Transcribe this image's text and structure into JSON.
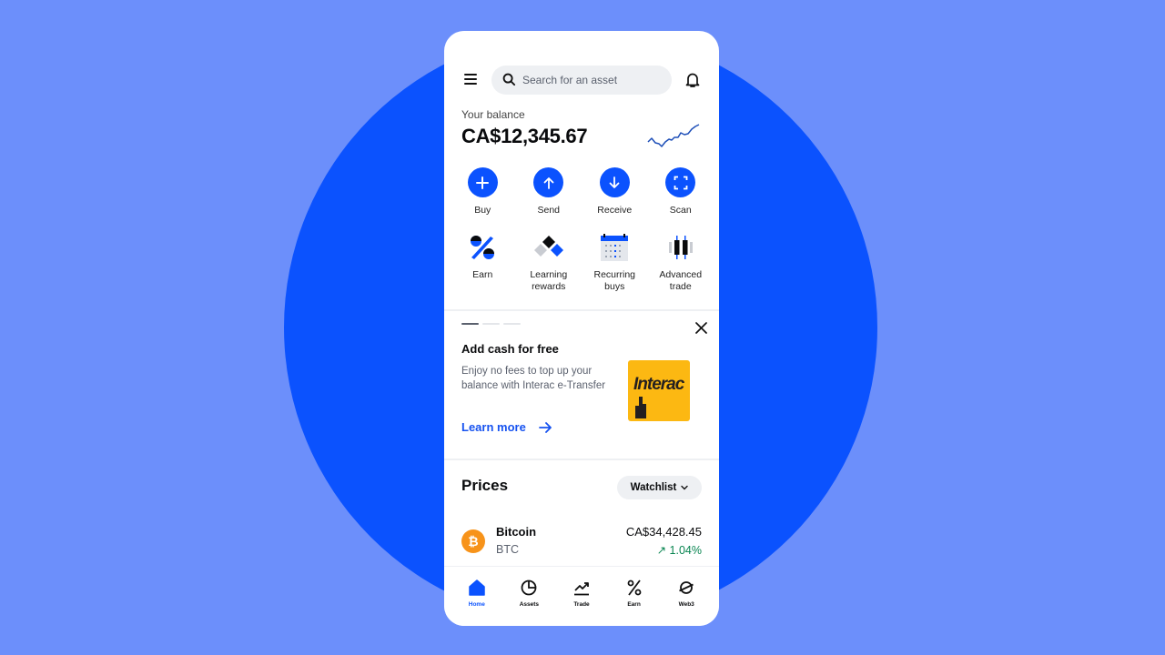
{
  "header": {
    "search_placeholder": "Search for an asset"
  },
  "balance": {
    "label": "Your balance",
    "value": "CA$12,345.67"
  },
  "actions": [
    {
      "label": "Buy",
      "icon": "plus-icon"
    },
    {
      "label": "Send",
      "icon": "arrow-up-icon"
    },
    {
      "label": "Receive",
      "icon": "arrow-down-icon"
    },
    {
      "label": "Scan",
      "icon": "scan-icon"
    }
  ],
  "features": [
    {
      "label_line1": "Earn",
      "label_line2": "",
      "icon": "percent-icon"
    },
    {
      "label_line1": "Learning",
      "label_line2": "rewards",
      "icon": "learning-rewards-icon"
    },
    {
      "label_line1": "Recurring",
      "label_line2": "buys",
      "icon": "calendar-icon"
    },
    {
      "label_line1": "Advanced",
      "label_line2": "trade",
      "icon": "candlestick-icon"
    }
  ],
  "promo": {
    "title": "Add cash for free",
    "text": "Enjoy no fees to top up your balance with Interac e-Transfer",
    "cta": "Learn more",
    "logo_text": "Interac",
    "page_count": 3,
    "active_page": 1
  },
  "prices": {
    "title": "Prices",
    "filter": "Watchlist",
    "assets": [
      {
        "name": "Bitcoin",
        "symbol": "BTC",
        "price": "CA$34,428.45",
        "change": "1.04%",
        "direction": "up"
      }
    ]
  },
  "bottom_nav": [
    {
      "label": "Home",
      "active": true
    },
    {
      "label": "Assets",
      "active": false
    },
    {
      "label": "Trade",
      "active": false
    },
    {
      "label": "Earn",
      "active": false
    },
    {
      "label": "Web3",
      "active": false
    }
  ],
  "colors": {
    "background": "#6c8ffb",
    "brand_blue": "#0b52fe",
    "positive": "#098551",
    "bitcoin": "#f7931a",
    "interac": "#fcb812"
  }
}
